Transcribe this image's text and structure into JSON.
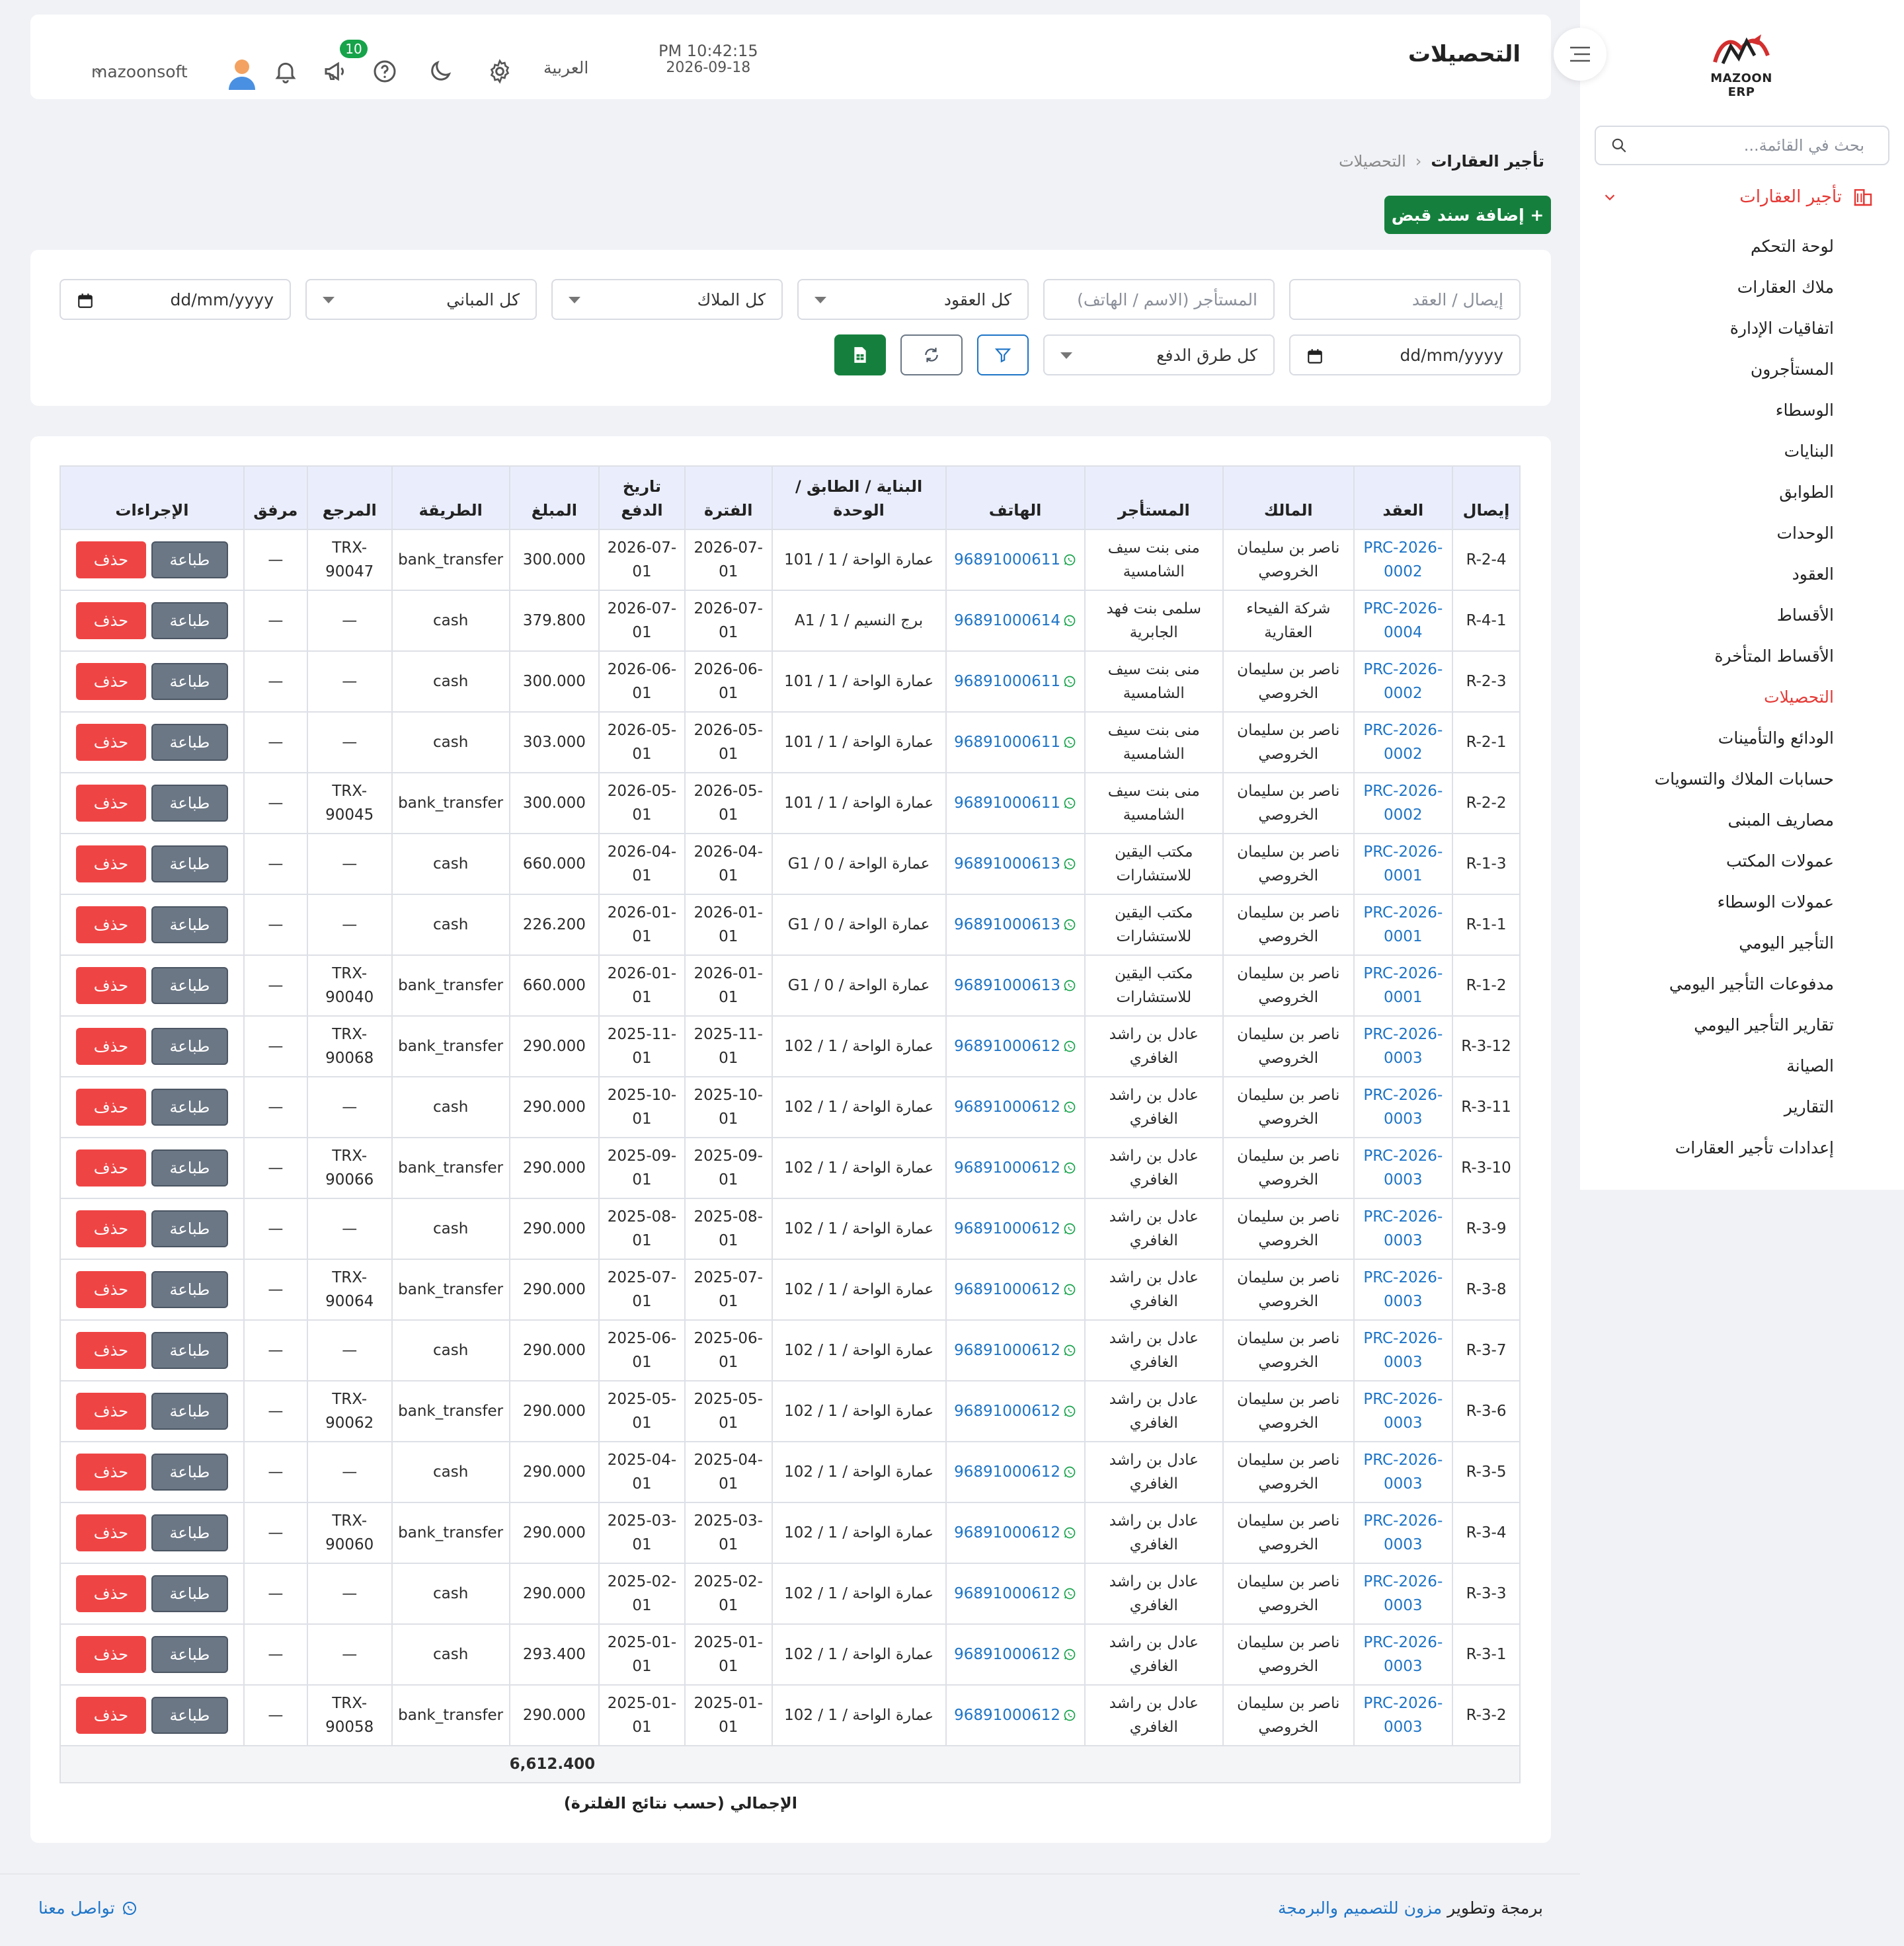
{
  "sidebar": {
    "logo_text": "MAZOON ERP",
    "search_placeholder": "بحث في القائمة...",
    "section": "تأجير العقارات",
    "items": [
      "لوحة التحكم",
      "ملاك العقارات",
      "اتفاقيات الإدارة",
      "المستأجرون",
      "الوسطاء",
      "البنايات",
      "الطوابق",
      "الوحدات",
      "العقود",
      "الأقساط",
      "الأقساط المتأخرة",
      "التحصيلات",
      "الودائع والتأمينات",
      "حسابات الملاك والتسويات",
      "مصاريف المبنى",
      "عمولات المكتب",
      "عمولات الوسطاء",
      "التأجير اليومي",
      "مدفوعات التأجير اليومي",
      "تقارير التأجير اليومي",
      "الصيانة",
      "التقارير",
      "إعدادات تأجير العقارات"
    ],
    "active_item": "التحصيلات"
  },
  "header": {
    "title": "التحصيلات",
    "time": "PM 10:42:15",
    "date": "2026-09-18",
    "language": "العربية",
    "notifications_badge": "10",
    "username": "mazoonsoft"
  },
  "breadcrumb": {
    "parent": "تأجير العقارات",
    "current": "التحصيلات"
  },
  "add_button": "+ إضافة سند قبض",
  "filters": {
    "receipt_contract_placeholder": "إيصال / العقد",
    "tenant_placeholder": "المستأجر (الاسم / الهاتف)",
    "contracts_select": "كل العقود",
    "owners_select": "كل الملاك",
    "buildings_select": "كل المباني",
    "date_from": "dd/mm/yyyy",
    "date_to": "dd/mm/yyyy",
    "payment_methods_select": "كل طرق الدفع"
  },
  "table": {
    "headers": [
      "إيصال",
      "العقد",
      "المالك",
      "المستأجر",
      "الهاتف",
      "البناية / الطابق / الوحدة",
      "الفترة",
      "تاريخ الدفع",
      "المبلغ",
      "الطريقة",
      "المرجع",
      "مرفق",
      "الإجراءات"
    ],
    "print_label": "طباعة",
    "delete_label": "حذف",
    "rows": [
      {
        "receipt": "R-2-4",
        "contract": "PRC-2026-0002",
        "owner": "ناصر بن سليمان الخروصي",
        "tenant": "منى بنت سيف الشامسية",
        "phone": "96891000611",
        "unit": "عمارة الواحة / 1 / 101",
        "period": "2026-07-01",
        "paid": "2026-07-01",
        "amount": "300.000",
        "method": "bank_transfer",
        "ref": "TRX-90047",
        "attach": "—"
      },
      {
        "receipt": "R-4-1",
        "contract": "PRC-2026-0004",
        "owner": "شركة الفيحاء العقارية",
        "tenant": "سلمى بنت فهد الجابرية",
        "phone": "96891000614",
        "unit": "برج النسيم / 1 / A1",
        "period": "2026-07-01",
        "paid": "2026-07-01",
        "amount": "379.800",
        "method": "cash",
        "ref": "—",
        "attach": "—"
      },
      {
        "receipt": "R-2-3",
        "contract": "PRC-2026-0002",
        "owner": "ناصر بن سليمان الخروصي",
        "tenant": "منى بنت سيف الشامسية",
        "phone": "96891000611",
        "unit": "عمارة الواحة / 1 / 101",
        "period": "2026-06-01",
        "paid": "2026-06-01",
        "amount": "300.000",
        "method": "cash",
        "ref": "—",
        "attach": "—"
      },
      {
        "receipt": "R-2-1",
        "contract": "PRC-2026-0002",
        "owner": "ناصر بن سليمان الخروصي",
        "tenant": "منى بنت سيف الشامسية",
        "phone": "96891000611",
        "unit": "عمارة الواحة / 1 / 101",
        "period": "2026-05-01",
        "paid": "2026-05-01",
        "amount": "303.000",
        "method": "cash",
        "ref": "—",
        "attach": "—"
      },
      {
        "receipt": "R-2-2",
        "contract": "PRC-2026-0002",
        "owner": "ناصر بن سليمان الخروصي",
        "tenant": "منى بنت سيف الشامسية",
        "phone": "96891000611",
        "unit": "عمارة الواحة / 1 / 101",
        "period": "2026-05-01",
        "paid": "2026-05-01",
        "amount": "300.000",
        "method": "bank_transfer",
        "ref": "TRX-90045",
        "attach": "—"
      },
      {
        "receipt": "R-1-3",
        "contract": "PRC-2026-0001",
        "owner": "ناصر بن سليمان الخروصي",
        "tenant": "مكتب اليقين للاستشارات",
        "phone": "96891000613",
        "unit": "عمارة الواحة / 0 / G1",
        "period": "2026-04-01",
        "paid": "2026-04-01",
        "amount": "660.000",
        "method": "cash",
        "ref": "—",
        "attach": "—"
      },
      {
        "receipt": "R-1-1",
        "contract": "PRC-2026-0001",
        "owner": "ناصر بن سليمان الخروصي",
        "tenant": "مكتب اليقين للاستشارات",
        "phone": "96891000613",
        "unit": "عمارة الواحة / 0 / G1",
        "period": "2026-01-01",
        "paid": "2026-01-01",
        "amount": "226.200",
        "method": "cash",
        "ref": "—",
        "attach": "—"
      },
      {
        "receipt": "R-1-2",
        "contract": "PRC-2026-0001",
        "owner": "ناصر بن سليمان الخروصي",
        "tenant": "مكتب اليقين للاستشارات",
        "phone": "96891000613",
        "unit": "عمارة الواحة / 0 / G1",
        "period": "2026-01-01",
        "paid": "2026-01-01",
        "amount": "660.000",
        "method": "bank_transfer",
        "ref": "TRX-90040",
        "attach": "—"
      },
      {
        "receipt": "R-3-12",
        "contract": "PRC-2026-0003",
        "owner": "ناصر بن سليمان الخروصي",
        "tenant": "عادل بن راشد الغافري",
        "phone": "96891000612",
        "unit": "عمارة الواحة / 1 / 102",
        "period": "2025-11-01",
        "paid": "2025-11-01",
        "amount": "290.000",
        "method": "bank_transfer",
        "ref": "TRX-90068",
        "attach": "—"
      },
      {
        "receipt": "R-3-11",
        "contract": "PRC-2026-0003",
        "owner": "ناصر بن سليمان الخروصي",
        "tenant": "عادل بن راشد الغافري",
        "phone": "96891000612",
        "unit": "عمارة الواحة / 1 / 102",
        "period": "2025-10-01",
        "paid": "2025-10-01",
        "amount": "290.000",
        "method": "cash",
        "ref": "—",
        "attach": "—"
      },
      {
        "receipt": "R-3-10",
        "contract": "PRC-2026-0003",
        "owner": "ناصر بن سليمان الخروصي",
        "tenant": "عادل بن راشد الغافري",
        "phone": "96891000612",
        "unit": "عمارة الواحة / 1 / 102",
        "period": "2025-09-01",
        "paid": "2025-09-01",
        "amount": "290.000",
        "method": "bank_transfer",
        "ref": "TRX-90066",
        "attach": "—"
      },
      {
        "receipt": "R-3-9",
        "contract": "PRC-2026-0003",
        "owner": "ناصر بن سليمان الخروصي",
        "tenant": "عادل بن راشد الغافري",
        "phone": "96891000612",
        "unit": "عمارة الواحة / 1 / 102",
        "period": "2025-08-01",
        "paid": "2025-08-01",
        "amount": "290.000",
        "method": "cash",
        "ref": "—",
        "attach": "—"
      },
      {
        "receipt": "R-3-8",
        "contract": "PRC-2026-0003",
        "owner": "ناصر بن سليمان الخروصي",
        "tenant": "عادل بن راشد الغافري",
        "phone": "96891000612",
        "unit": "عمارة الواحة / 1 / 102",
        "period": "2025-07-01",
        "paid": "2025-07-01",
        "amount": "290.000",
        "method": "bank_transfer",
        "ref": "TRX-90064",
        "attach": "—"
      },
      {
        "receipt": "R-3-7",
        "contract": "PRC-2026-0003",
        "owner": "ناصر بن سليمان الخروصي",
        "tenant": "عادل بن راشد الغافري",
        "phone": "96891000612",
        "unit": "عمارة الواحة / 1 / 102",
        "period": "2025-06-01",
        "paid": "2025-06-01",
        "amount": "290.000",
        "method": "cash",
        "ref": "—",
        "attach": "—"
      },
      {
        "receipt": "R-3-6",
        "contract": "PRC-2026-0003",
        "owner": "ناصر بن سليمان الخروصي",
        "tenant": "عادل بن راشد الغافري",
        "phone": "96891000612",
        "unit": "عمارة الواحة / 1 / 102",
        "period": "2025-05-01",
        "paid": "2025-05-01",
        "amount": "290.000",
        "method": "bank_transfer",
        "ref": "TRX-90062",
        "attach": "—"
      },
      {
        "receipt": "R-3-5",
        "contract": "PRC-2026-0003",
        "owner": "ناصر بن سليمان الخروصي",
        "tenant": "عادل بن راشد الغافري",
        "phone": "96891000612",
        "unit": "عمارة الواحة / 1 / 102",
        "period": "2025-04-01",
        "paid": "2025-04-01",
        "amount": "290.000",
        "method": "cash",
        "ref": "—",
        "attach": "—"
      },
      {
        "receipt": "R-3-4",
        "contract": "PRC-2026-0003",
        "owner": "ناصر بن سليمان الخروصي",
        "tenant": "عادل بن راشد الغافري",
        "phone": "96891000612",
        "unit": "عمارة الواحة / 1 / 102",
        "period": "2025-03-01",
        "paid": "2025-03-01",
        "amount": "290.000",
        "method": "bank_transfer",
        "ref": "TRX-90060",
        "attach": "—"
      },
      {
        "receipt": "R-3-3",
        "contract": "PRC-2026-0003",
        "owner": "ناصر بن سليمان الخروصي",
        "tenant": "عادل بن راشد الغافري",
        "phone": "96891000612",
        "unit": "عمارة الواحة / 1 / 102",
        "period": "2025-02-01",
        "paid": "2025-02-01",
        "amount": "290.000",
        "method": "cash",
        "ref": "—",
        "attach": "—"
      },
      {
        "receipt": "R-3-1",
        "contract": "PRC-2026-0003",
        "owner": "ناصر بن سليمان الخروصي",
        "tenant": "عادل بن راشد الغافري",
        "phone": "96891000612",
        "unit": "عمارة الواحة / 1 / 102",
        "period": "2025-01-01",
        "paid": "2025-01-01",
        "amount": "293.400",
        "method": "cash",
        "ref": "—",
        "attach": "—"
      },
      {
        "receipt": "R-3-2",
        "contract": "PRC-2026-0003",
        "owner": "ناصر بن سليمان الخروصي",
        "tenant": "عادل بن راشد الغافري",
        "phone": "96891000612",
        "unit": "عمارة الواحة / 1 / 102",
        "period": "2025-01-01",
        "paid": "2025-01-01",
        "amount": "290.000",
        "method": "bank_transfer",
        "ref": "TRX-90058",
        "attach": "—"
      }
    ],
    "total_label": "الإجمالي (حسب نتائج الفلترة)",
    "total_amount": "6,612.400"
  },
  "footer": {
    "credit_prefix": "برمجة وتطوير",
    "credit_brand": "مزون للتصميم والبرمجة",
    "contact": "تواصل معنا"
  },
  "colors": {
    "accent_red": "#e53935",
    "primary_green": "#15803d",
    "link_blue": "#1d74c7",
    "delete_red": "#ef4444",
    "print_gray": "#6b7785"
  }
}
